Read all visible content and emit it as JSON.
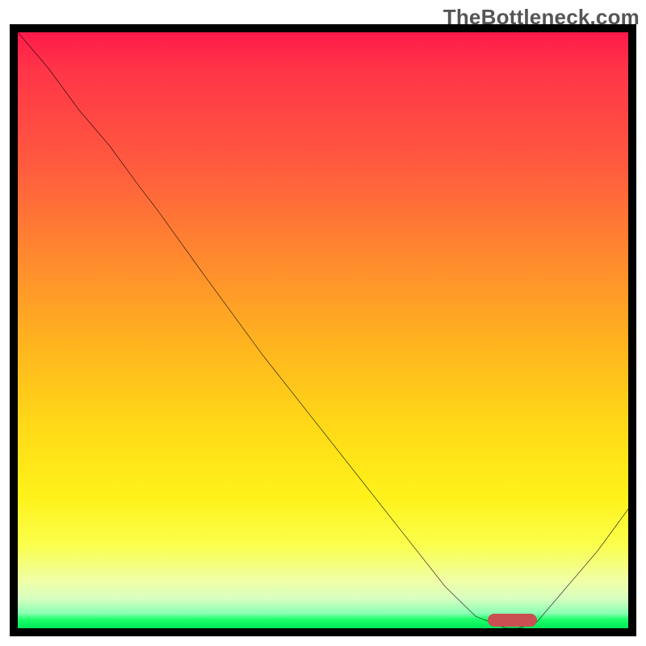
{
  "watermark": "TheBottleneck.com",
  "colors": {
    "gradient_top": "#ff1a4a",
    "gradient_mid": "#ffd917",
    "gradient_bottom": "#00e85a",
    "curve": "#000000",
    "optimum_marker": "#c94f53",
    "frame": "#000000"
  },
  "chart_data": {
    "type": "line",
    "title": "",
    "xlabel": "",
    "ylabel": "",
    "xlim": [
      0,
      100
    ],
    "ylim": [
      0,
      100
    ],
    "grid": false,
    "legend": false,
    "series": [
      {
        "name": "bottleneck-curve",
        "x": [
          0,
          5,
          10,
          15,
          20,
          23,
          30,
          40,
          50,
          60,
          70,
          75,
          80,
          82,
          85,
          90,
          95,
          100
        ],
        "y": [
          100,
          94,
          87,
          81,
          74,
          70,
          60,
          46,
          33,
          20,
          7,
          2,
          0,
          0,
          1,
          7,
          13,
          20
        ]
      }
    ],
    "optimum_range_x": [
      77,
      85
    ],
    "note": "x and y are normalized 0–100; y=0 is the bottom (green) edge, y=100 is the top (red) edge. Curve starts at top-left, descends, flattens near the bottom around x≈78–84, then rises toward the right edge."
  }
}
